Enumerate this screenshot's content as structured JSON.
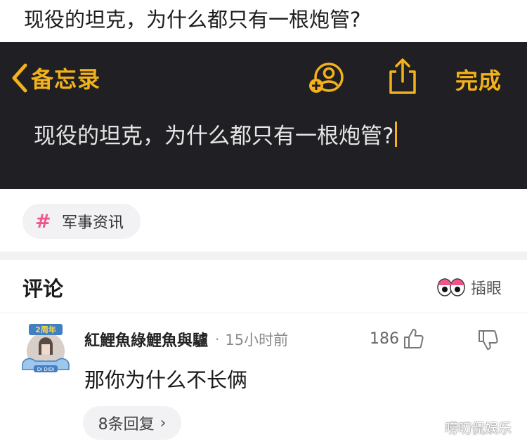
{
  "post": {
    "title": "现役的坦克，为什么都只有一根炮管?"
  },
  "notes_screenshot": {
    "back_label": "备忘录",
    "done_label": "完成",
    "note_text": "现役的坦克，为什么都只有一根炮管?",
    "accent_color": "#f4b21a",
    "background_color": "#1f1f24"
  },
  "topic": {
    "label": "军事资讯",
    "hash_symbol": "#",
    "hash_color": "#f0558a"
  },
  "comments": {
    "heading": "评论",
    "peek_label": "插眼",
    "items": [
      {
        "author": "紅鯉魚綠鯉魚與驢",
        "separator": "·",
        "time": "15小时前",
        "likes": "186",
        "text": "那你为什么不长俩",
        "avatar_badge": "2周年",
        "avatar_tag": "DI DIDI",
        "replies_label": "8条回复",
        "replies_chevron": "›"
      }
    ]
  },
  "watermark": "唠叨侃娱乐",
  "icons": {
    "back": "chevron-left-icon",
    "add_person": "add-person-icon",
    "share": "share-icon",
    "like": "thumbs-up-icon",
    "dislike": "thumbs-down-icon",
    "peek": "eyes-icon"
  }
}
